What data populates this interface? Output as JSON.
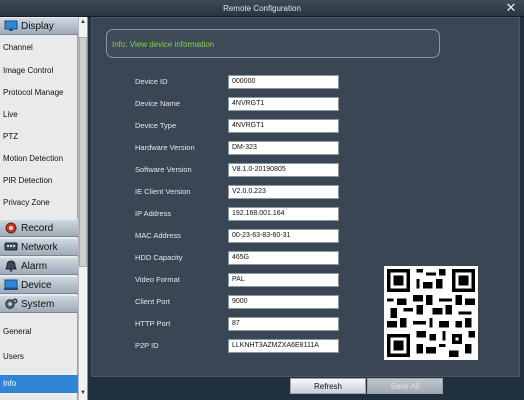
{
  "window": {
    "title": "Remote Configuration",
    "close_glyph": "✕"
  },
  "sidebar": {
    "categories": {
      "display": "Display",
      "record": "Record",
      "network": "Network",
      "alarm": "Alarm",
      "device": "Device",
      "system": "System"
    },
    "display_items": [
      "Channel",
      "Image Control",
      "Protocol Manage",
      "Live",
      "PTZ",
      "Motion Detection",
      "PIR Detection",
      "Privacy Zone"
    ],
    "system_items": [
      "General",
      "Users",
      "Info"
    ],
    "active_item": "Info"
  },
  "info": {
    "header": "Info: View device information",
    "fields": [
      {
        "label": "Device ID",
        "value": "000000"
      },
      {
        "label": "Device Name",
        "value": "4NVRGT1"
      },
      {
        "label": "Device Type",
        "value": "4NVRGT1"
      },
      {
        "label": "Hardware Version",
        "value": "DM-323"
      },
      {
        "label": "Software Version",
        "value": "V8.1.0-20190805"
      },
      {
        "label": "IE Client Version",
        "value": "V2.0.0.223"
      },
      {
        "label": "IP Address",
        "value": "192.168.001.164"
      },
      {
        "label": "MAC Address",
        "value": "00-23-63-83-60-31"
      },
      {
        "label": "HDD Capacity",
        "value": "465G"
      },
      {
        "label": "Video Format",
        "value": "PAL"
      },
      {
        "label": "Client Port",
        "value": "9000"
      },
      {
        "label": "HTTP Port",
        "value": "87"
      },
      {
        "label": "P2P ID",
        "value": "LLKNHT3AZMZXA6E8111A"
      }
    ]
  },
  "buttons": {
    "refresh": "Refresh",
    "save_all": "Save All"
  },
  "colors": {
    "accent": "#2f86d6",
    "info_header": "#86d04c",
    "panel": "#3a4654",
    "window_bg": "#1f2d3d"
  }
}
